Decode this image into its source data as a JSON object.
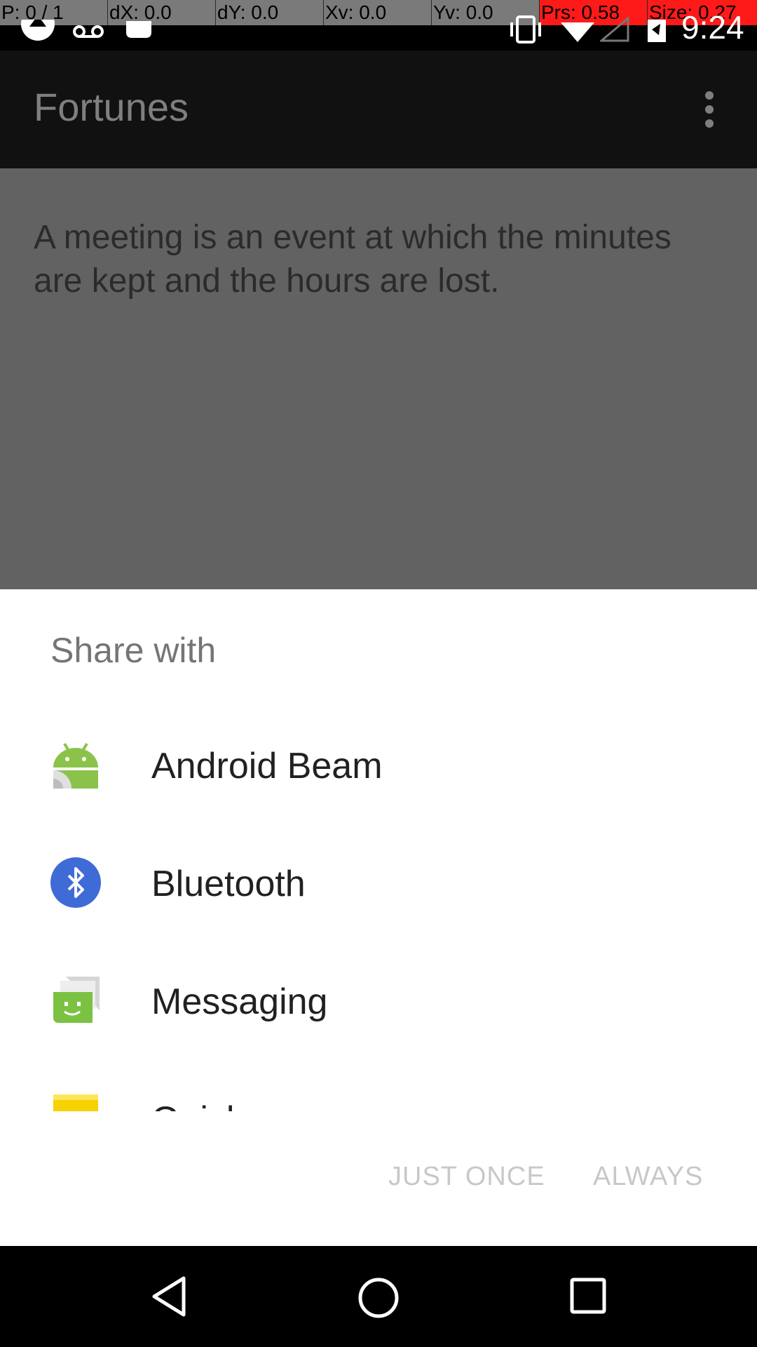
{
  "debug_bar": {
    "pointer": "P: 0 / 1",
    "dx": "dX: 0.0",
    "dy": "dY: 0.0",
    "xv": "Xv: 0.0",
    "yv": "Yv: 0.0",
    "prs": "Prs: 0.58",
    "size": "Size: 0.27"
  },
  "status": {
    "time": "9:24"
  },
  "app": {
    "title": "Fortunes",
    "fortune_text": "A meeting is an event at which the minutes are kept and the hours are lost."
  },
  "share_sheet": {
    "title": "Share with",
    "items": [
      {
        "label": "Android Beam",
        "icon": "android-beam-icon"
      },
      {
        "label": "Bluetooth",
        "icon": "bluetooth-icon"
      },
      {
        "label": "Messaging",
        "icon": "messaging-icon"
      },
      {
        "label": "Quickmemo",
        "icon": "memo-icon"
      }
    ],
    "buttons": {
      "just_once": "JUST ONCE",
      "always": "ALWAYS"
    }
  },
  "colors": {
    "bluetooth": "#3F6BD6",
    "android_green": "#8BC34A",
    "messaging_green": "#7CC242",
    "memo_yellow": "#F5D200",
    "debug_highlight": "#FF1A1A"
  }
}
